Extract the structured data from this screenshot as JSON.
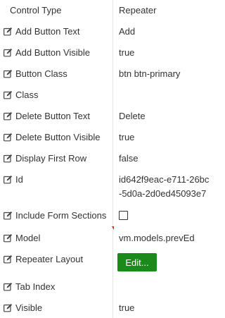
{
  "header": {
    "name": "Control Type",
    "value": "Repeater"
  },
  "properties": [
    {
      "name": "Add Button Text",
      "value": "Add"
    },
    {
      "name": "Add Button Visible",
      "value": "true"
    },
    {
      "name": "Button Class",
      "value": "btn btn-primary"
    },
    {
      "name": "Class",
      "value": ""
    },
    {
      "name": "Delete Button Text",
      "value": "Delete"
    },
    {
      "name": "Delete Button Visible",
      "value": "true"
    },
    {
      "name": "Display First Row",
      "value": "false"
    },
    {
      "name": "Id",
      "value": "id642f9eac-e711-26bc-5d0a-2d0ed45093e7"
    },
    {
      "name": "Include Form Sections",
      "checked": false
    },
    {
      "name": "Model",
      "value": "vm.models.prevEd"
    },
    {
      "name": "Repeater Layout",
      "button_label": "Edit..."
    },
    {
      "name": "Tab Index",
      "value": ""
    },
    {
      "name": "Visible",
      "value": "true"
    }
  ],
  "colors": {
    "edit_button_bg": "#1a8a1a",
    "marker": "#d9231f",
    "divider": "#e3e3e3"
  },
  "icons": {
    "row_icon": "edit-icon"
  }
}
